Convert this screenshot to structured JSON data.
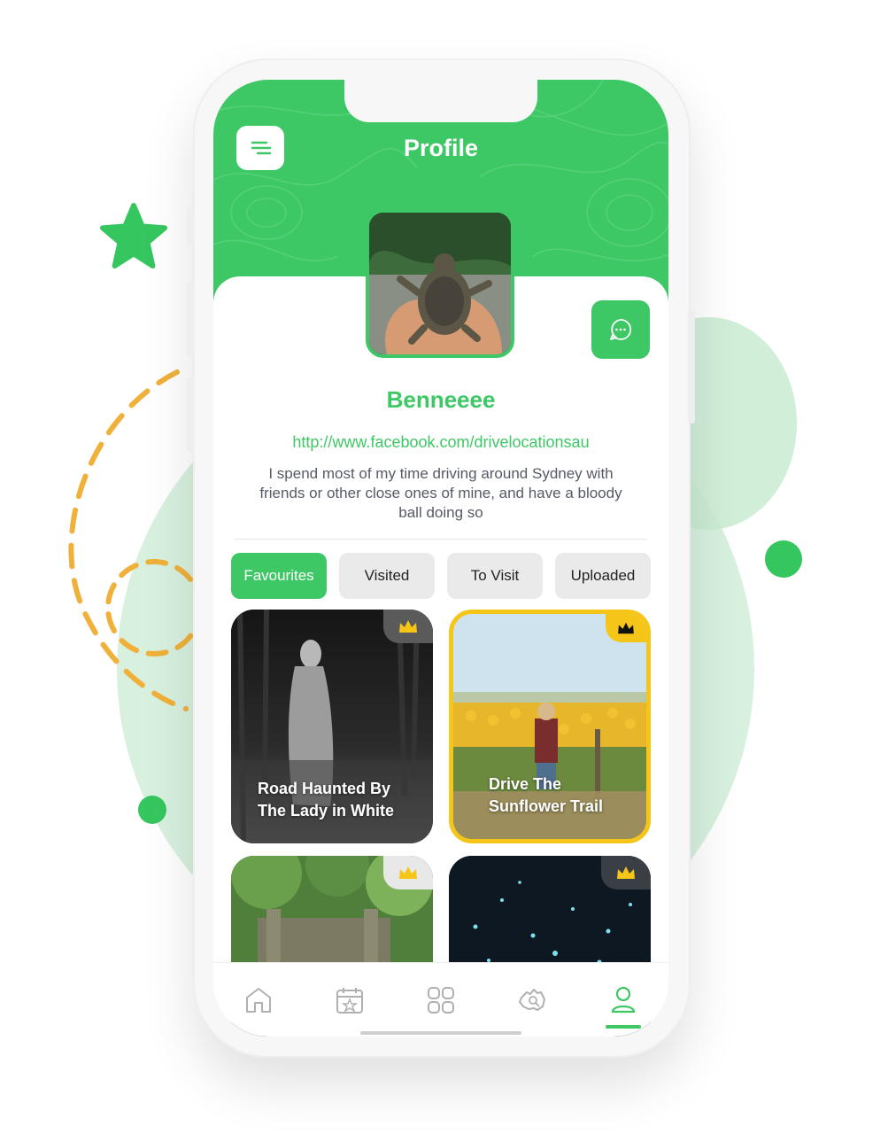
{
  "header": {
    "title": "Profile"
  },
  "profile": {
    "username": "Benneeee",
    "link": "http://www.facebook.com/drivelocationsau",
    "bio": "I spend most of my time driving around Sydney with friends or other close ones of mine, and have a bloody ball doing so"
  },
  "tabs": [
    {
      "label": "Favourites",
      "active": true
    },
    {
      "label": "Visited",
      "active": false
    },
    {
      "label": "To Visit",
      "active": false
    },
    {
      "label": "Uploaded",
      "active": false
    }
  ],
  "cards": [
    {
      "title_line1": "Road Haunted By",
      "title_line2": "The Lady in White",
      "premium_style": "dark"
    },
    {
      "title_line1": "Drive The",
      "title_line2": "Sunflower Trail",
      "premium_style": "gold"
    },
    {
      "title_line1": "",
      "title_line2": "",
      "premium_style": "light"
    },
    {
      "title_line1": "",
      "title_line2": "",
      "premium_style": "dark"
    }
  ],
  "nav": [
    {
      "icon": "home-icon",
      "active": false
    },
    {
      "icon": "calendar-star-icon",
      "active": false
    },
    {
      "icon": "grid-icon",
      "active": false
    },
    {
      "icon": "australia-map-icon",
      "active": false
    },
    {
      "icon": "user-icon",
      "active": true
    }
  ],
  "colors": {
    "brand_green": "#3ec765",
    "gold": "#f5c518"
  }
}
